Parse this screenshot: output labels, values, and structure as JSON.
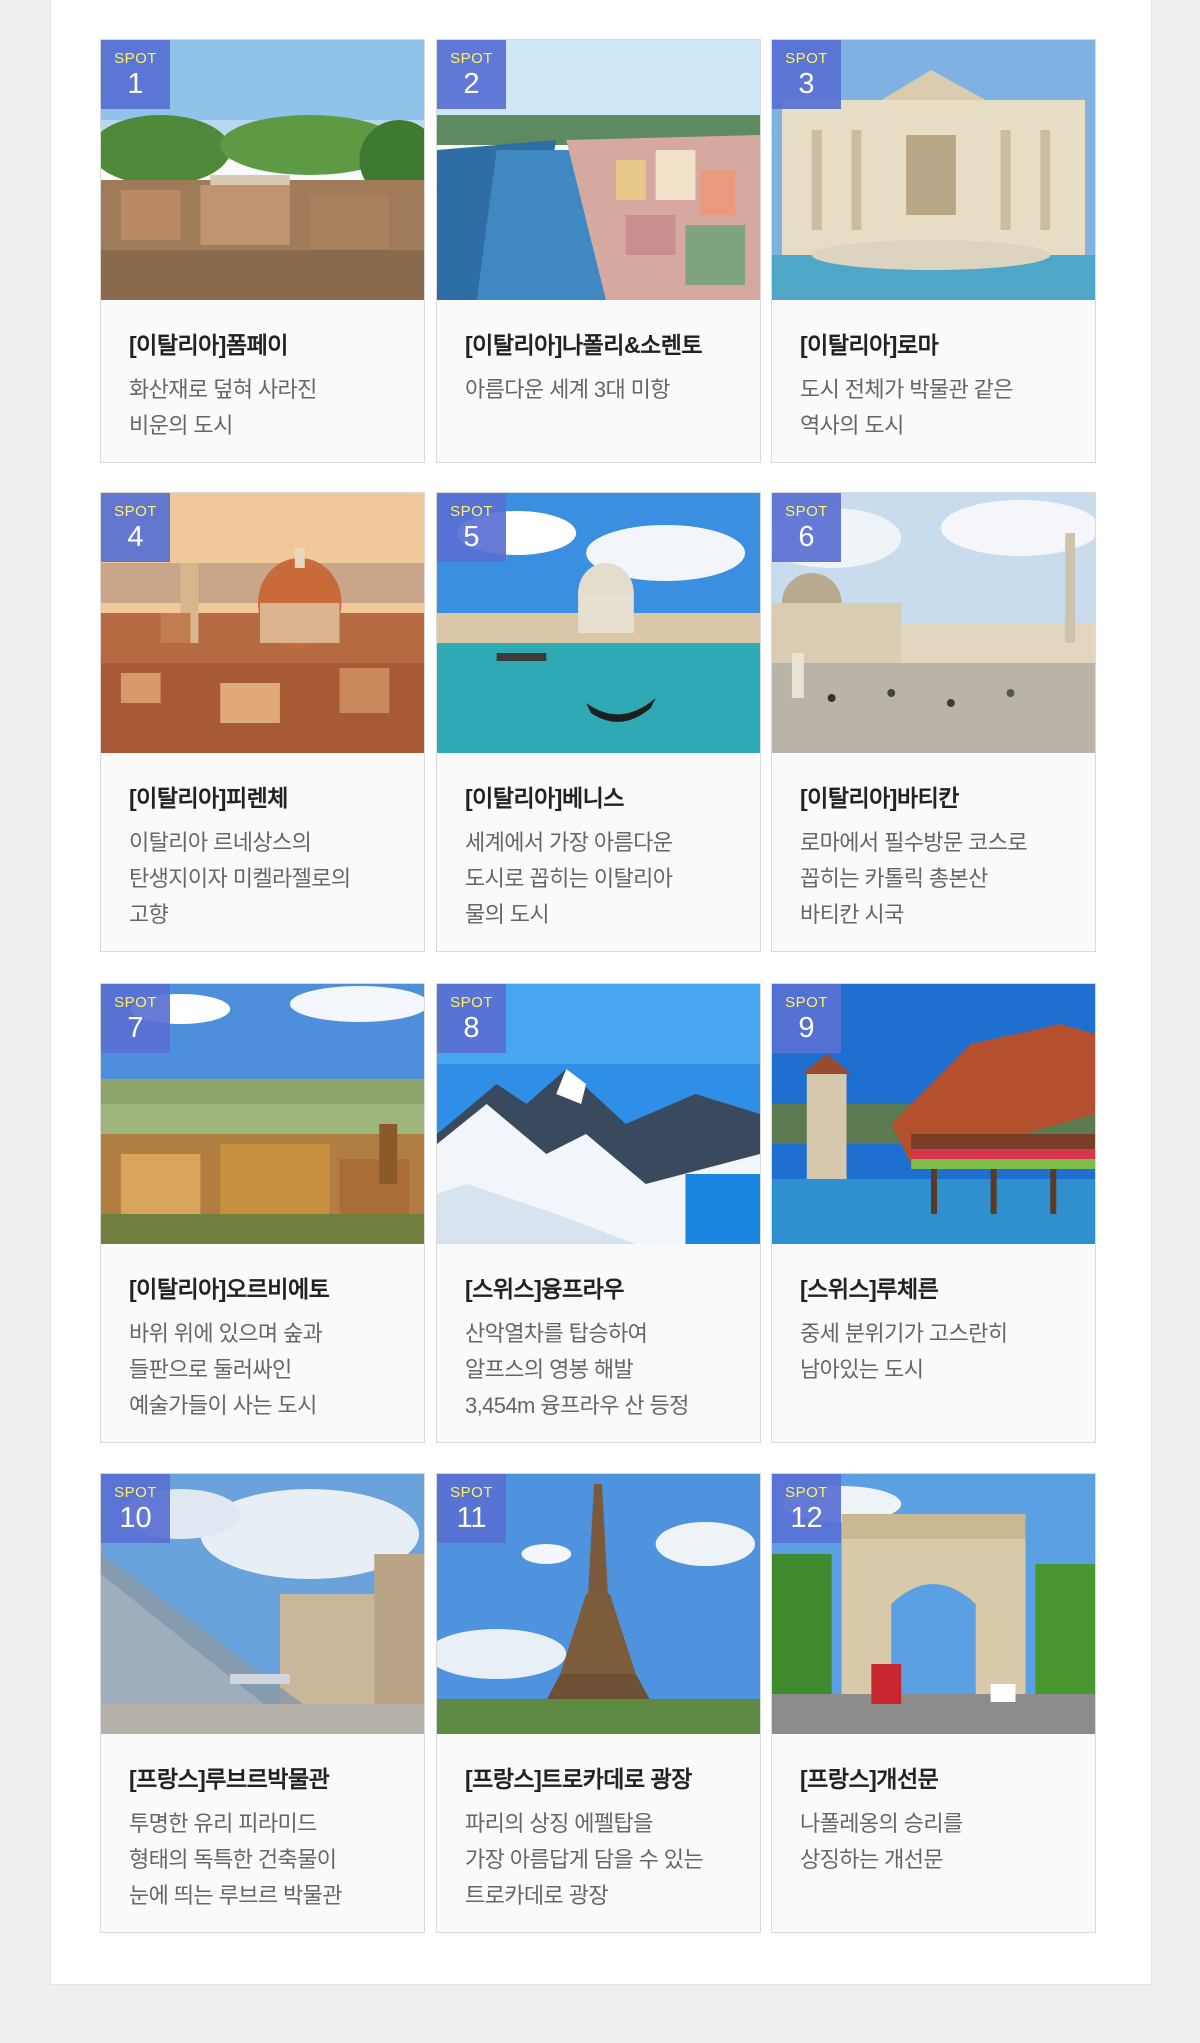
{
  "badge_prefix": "SPOT",
  "colors": {
    "badge_bg": "#5870d2",
    "badge_spot_text": "#fff36b",
    "title": "#222222",
    "desc": "#666666"
  },
  "spots": [
    {
      "num": "1",
      "title": "[이탈리아]폼페이",
      "desc": [
        "화산재로 덮혀 사라진",
        "비운의 도시"
      ],
      "scene": "ruins"
    },
    {
      "num": "2",
      "title": "[이탈리아]나폴리&소렌토",
      "desc": [
        "아름다운 세계 3대 미항"
      ],
      "scene": "harbor"
    },
    {
      "num": "3",
      "title": "[이탈리아]로마",
      "desc": [
        "도시 전체가 박물관 같은",
        "역사의 도시"
      ],
      "scene": "fountain"
    },
    {
      "num": "4",
      "title": "[이탈리아]피렌체",
      "desc": [
        "이탈리아 르네상스의",
        "탄생지이자 미켈라젤로의",
        "고향"
      ],
      "scene": "dome-city"
    },
    {
      "num": "5",
      "title": "[이탈리아]베니스",
      "desc": [
        "세계에서 가장 아름다운",
        "도시로 꼽히는 이탈리아",
        "물의 도시"
      ],
      "scene": "canal"
    },
    {
      "num": "6",
      "title": "[이탈리아]바티칸",
      "desc": [
        "로마에서 필수방문 코스로",
        "꼽히는 카톨릭 총본산",
        "바티칸 시국"
      ],
      "scene": "square"
    },
    {
      "num": "7",
      "title": "[이탈리아]오르비에토",
      "desc": [
        "바위 위에 있으며 숲과",
        "들판으로 둘러싸인",
        "예술가들이 사는 도시"
      ],
      "scene": "hilltown"
    },
    {
      "num": "8",
      "title": "[스위스]융프라우",
      "desc": [
        "산악열차를 탑승하여",
        "알프스의 영봉 해발",
        "3,454m 융프라우 산 등정"
      ],
      "scene": "mountain"
    },
    {
      "num": "9",
      "title": "[스위스]루체른",
      "desc": [
        "중세 분위기가 고스란히",
        "남아있는 도시"
      ],
      "scene": "bridge"
    },
    {
      "num": "10",
      "title": "[프랑스]루브르박물관",
      "desc": [
        "투명한 유리 피라미드",
        "형태의 독특한 건축물이",
        "눈에 띄는 루브르 박물관"
      ],
      "scene": "pyramid"
    },
    {
      "num": "11",
      "title": "[프랑스]트로카데로 광장",
      "desc": [
        "파리의 상징 에펠탑을",
        "가장 아름답게 담을 수 있는",
        "트로카데로 광장"
      ],
      "scene": "tower"
    },
    {
      "num": "12",
      "title": "[프랑스]개선문",
      "desc": [
        "나폴레옹의 승리를",
        "상징하는 개선문"
      ],
      "scene": "arch"
    }
  ]
}
